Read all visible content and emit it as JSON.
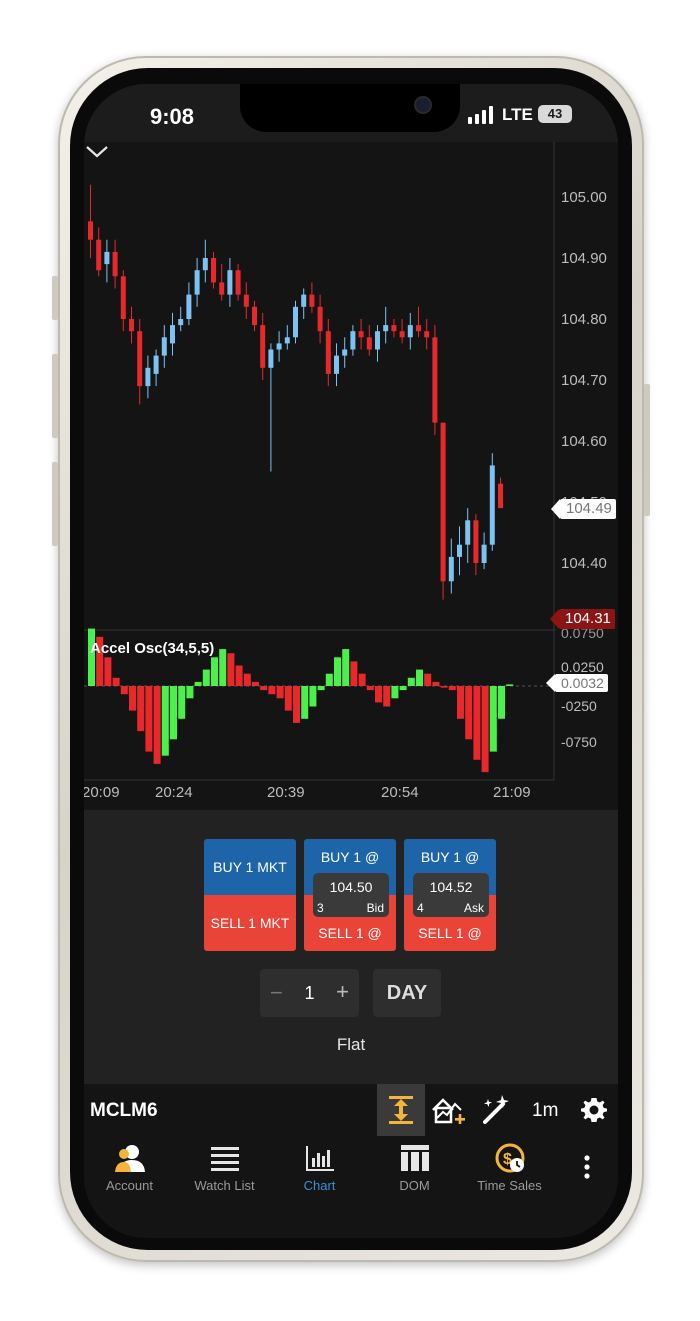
{
  "status": {
    "time": "9:08",
    "network": "LTE",
    "battery": "43"
  },
  "chart": {
    "y_axis_labels": [
      "105.00",
      "104.90",
      "104.80",
      "104.70",
      "104.60",
      "104.50",
      "104.40"
    ],
    "current_price": "104.49",
    "last_price": "104.31",
    "indicator_name": "Accel Osc(34,5,5)",
    "indicator_axis_labels": [
      "0.0750",
      "0.0250",
      "-0250",
      "-0750"
    ],
    "indicator_value": "0.0032",
    "x_axis_labels": [
      "20:09",
      "20:24",
      "20:39",
      "20:54",
      "21:09"
    ],
    "up_color": "#7cc3f2",
    "down_color": "#e8282b"
  },
  "trade": {
    "buy_market_label": "BUY 1 MKT",
    "sell_market_label": "SELL 1 MKT",
    "buy_limit_label": "BUY 1 @",
    "sell_limit_label": "SELL 1 @",
    "bid": {
      "price": "104.50",
      "size": "3",
      "side": "Bid"
    },
    "ask": {
      "price": "104.52",
      "size": "4",
      "side": "Ask"
    },
    "quantity": "1",
    "quantity_minus": "−",
    "quantity_plus": "+",
    "time_in_force": "DAY",
    "position": "Flat"
  },
  "toolbar": {
    "symbol": "MCLM6",
    "timeframe": "1m"
  },
  "tabs": [
    {
      "label": "Account",
      "icon": "account-icon"
    },
    {
      "label": "Watch List",
      "icon": "watch-list-icon"
    },
    {
      "label": "Chart",
      "icon": "chart-icon",
      "active": true
    },
    {
      "label": "DOM",
      "icon": "dom-icon"
    },
    {
      "label": "Time Sales",
      "icon": "time-sales-icon"
    }
  ],
  "colors": {
    "buy": "#1d65a8",
    "sell": "#ea4438",
    "accent": "#3a8fd8",
    "background": "#141414"
  }
}
